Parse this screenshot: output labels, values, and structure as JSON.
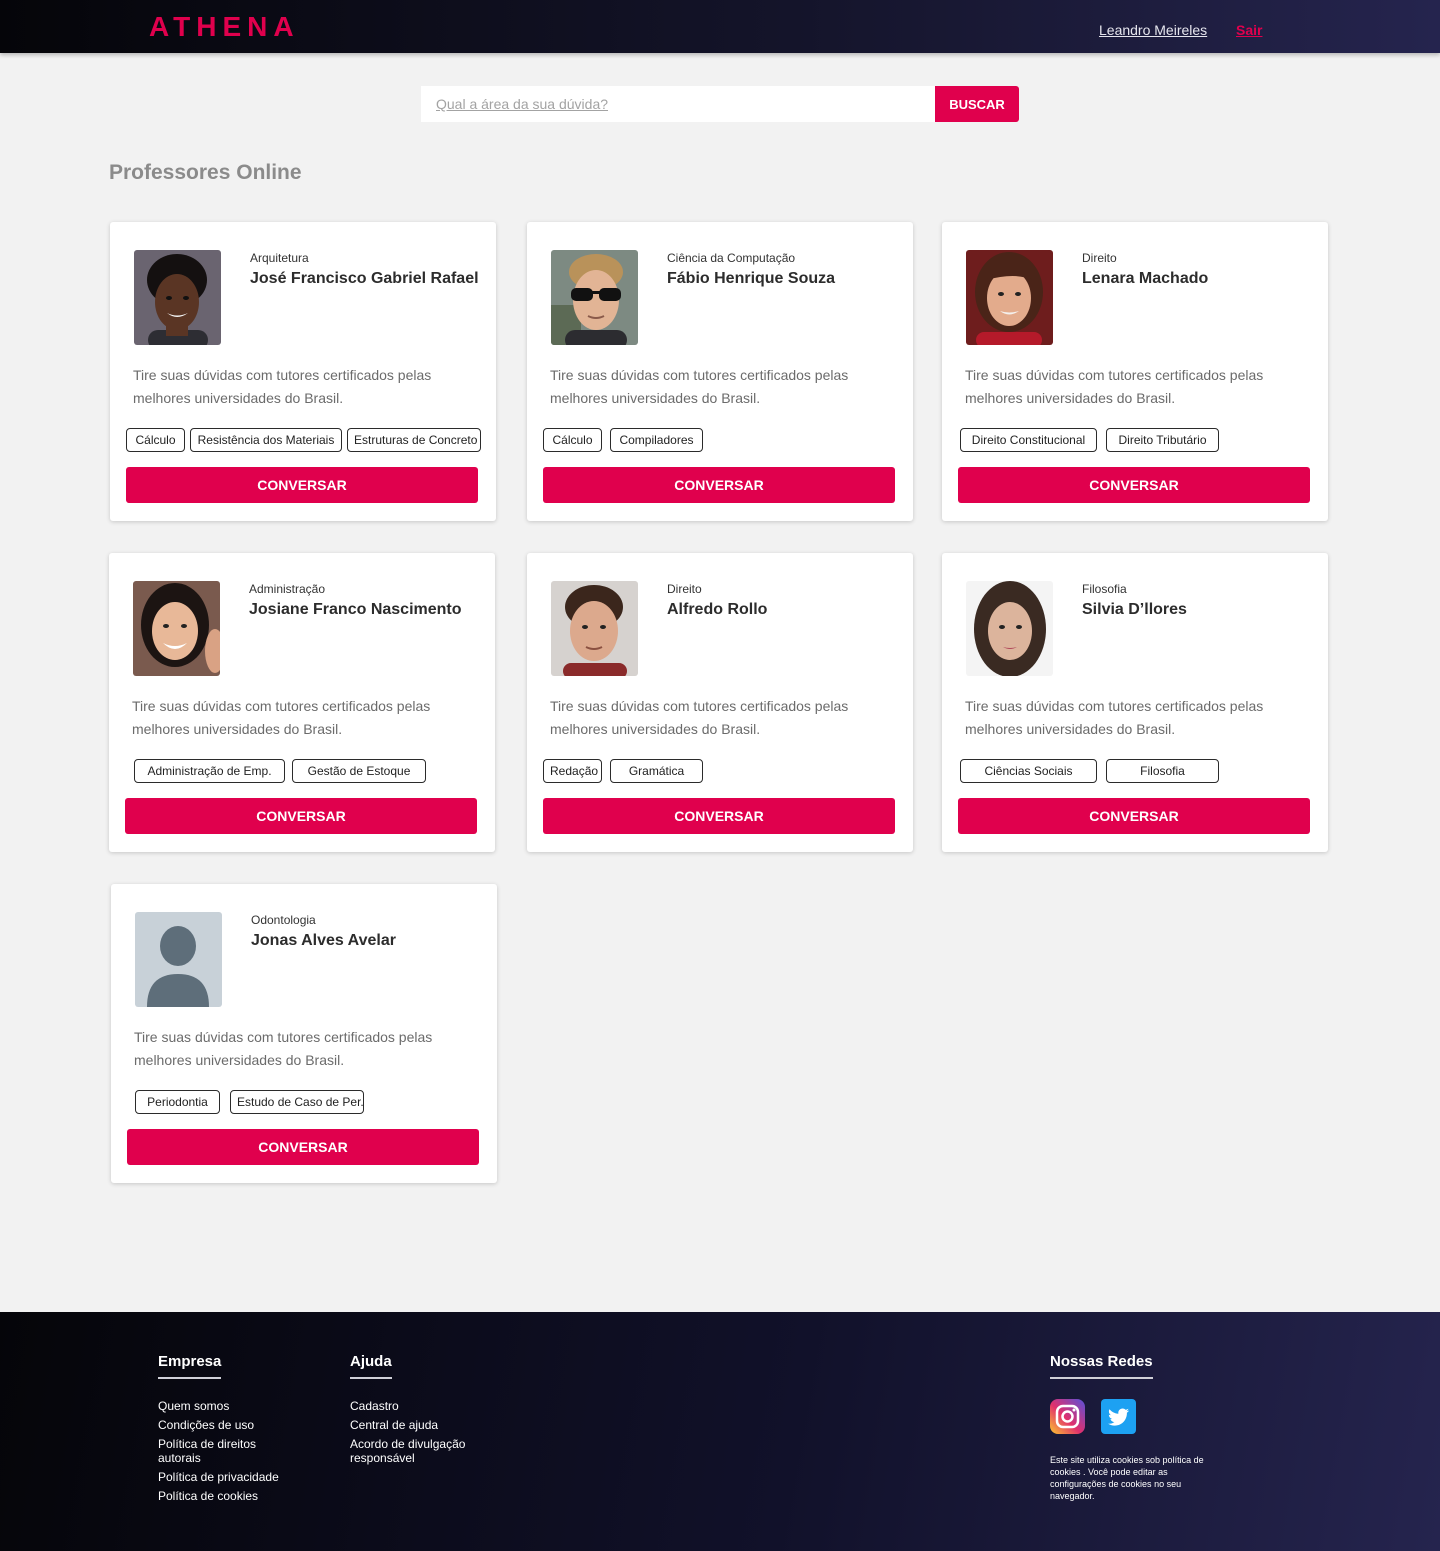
{
  "header": {
    "logo": "ATHENA",
    "user_name": "Leandro Meireles",
    "logout": "Sair"
  },
  "search": {
    "placeholder": "Qual a área da sua dúvida?",
    "button": "BUSCAR"
  },
  "section_title": "Professores Online",
  "colors": {
    "accent": "#e0004d",
    "header_dark": "#050509",
    "header_light": "#25244e"
  },
  "cards": [
    {
      "area": "Arquitetura",
      "name": "José Francisco Gabriel Rafael",
      "description": "Tire suas dúvidas com tutores certificados pelas melhores universidades do Brasil.",
      "tags": [
        "Cálculo",
        "Resistência dos Materiais",
        "Estruturas de Concreto"
      ],
      "button": "CONVERSAR",
      "avatar": "photo-man-curly-hair"
    },
    {
      "area": "Ciência da Computação",
      "name": "Fábio Henrique Souza",
      "description": "Tire suas dúvidas com tutores certificados pelas melhores universidades do Brasil.",
      "tags": [
        "Cálculo",
        "Compiladores"
      ],
      "button": "CONVERSAR",
      "avatar": "photo-man-sunglasses"
    },
    {
      "area": "Direito",
      "name": "Lenara Machado",
      "description": "Tire suas dúvidas com tutores certificados pelas melhores universidades do Brasil.",
      "tags": [
        "Direito Constitucional",
        "Direito Tributário"
      ],
      "button": "CONVERSAR",
      "avatar": "photo-woman-brown-hair"
    },
    {
      "area": "Administração",
      "name": "Josiane Franco Nascimento",
      "description": "Tire suas dúvidas com tutores certificados pelas melhores universidades do Brasil.",
      "tags": [
        "Administração de Emp.",
        "Gestão de Estoque"
      ],
      "button": "CONVERSAR",
      "avatar": "photo-woman-smiling"
    },
    {
      "area": "Direito",
      "name": "Alfredo Rollo",
      "description": "Tire suas dúvidas com tutores certificados pelas melhores universidades do Brasil.",
      "tags": [
        "Redação",
        "Gramática"
      ],
      "button": "CONVERSAR",
      "avatar": "photo-man-short-hair"
    },
    {
      "area": "Filosofia",
      "name": "Silvia D’llores",
      "description": "Tire suas dúvidas com tutores certificados pelas melhores universidades do Brasil.",
      "tags": [
        "Ciências Sociais",
        "Filosofia"
      ],
      "button": "CONVERSAR",
      "avatar": "photo-woman-long-hair"
    },
    {
      "area": "Odontologia",
      "name": "Jonas Alves Avelar",
      "description": "Tire suas dúvidas com tutores certificados pelas melhores universidades do Brasil.",
      "tags": [
        "Periodontia",
        "Estudo de Caso de Per."
      ],
      "button": "CONVERSAR",
      "avatar": "placeholder-person"
    }
  ],
  "footer": {
    "empresa": {
      "title": "Empresa",
      "links": [
        "Quem somos",
        "Condições de uso",
        "Política de direitos autorais",
        "Política de privacidade",
        "Política de cookies"
      ]
    },
    "ajuda": {
      "title": "Ajuda",
      "links": [
        "Cadastro",
        "Central de ajuda",
        "Acordo de divulgação responsável"
      ]
    },
    "redes": {
      "title": "Nossas Redes",
      "icons": [
        "instagram-icon",
        "twitter-icon"
      ],
      "cookie_notice": "Este site utiliza cookies sob política de cookies . Você pode editar as configurações de cookies no seu navegador."
    }
  }
}
